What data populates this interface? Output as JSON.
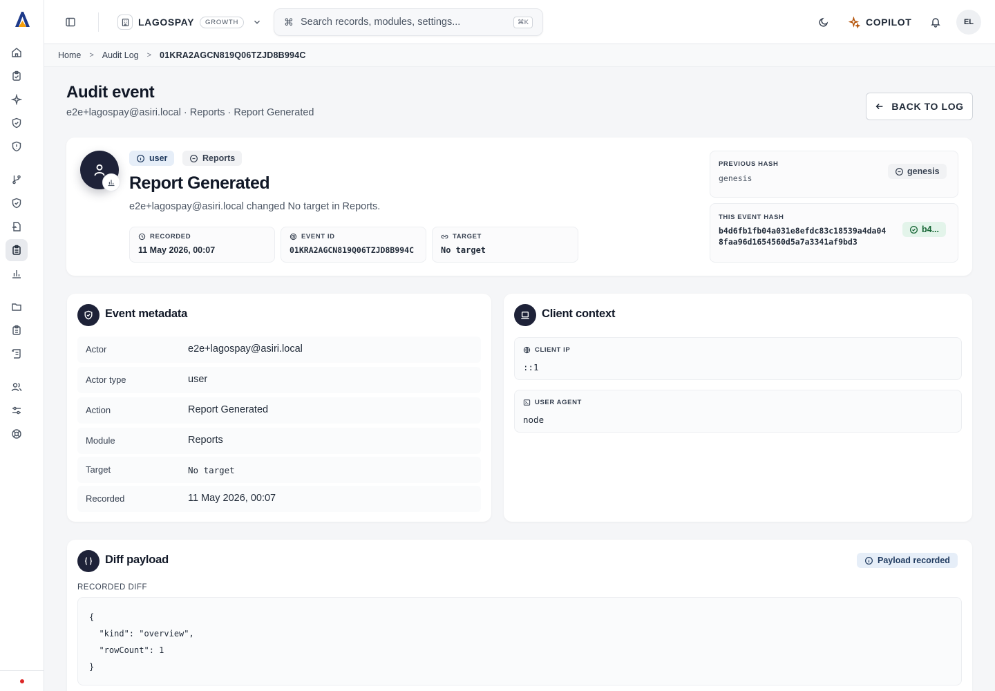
{
  "topbar": {
    "org_name": "LAGOSPAY",
    "org_plan": "GROWTH",
    "search_placeholder": "Search records, modules, settings...",
    "search_shortcut": "⌘K",
    "copilot_label": "COPILOT",
    "avatar_initials": "EL"
  },
  "breadcrumb": [
    "Home",
    "Audit Log",
    "01KRA2AGCN819Q06TZJD8B994C"
  ],
  "header": {
    "title": "Audit event",
    "subtitle": "e2e+lagospay@asiri.local · Reports · Report Generated",
    "back_label": "BACK TO LOG"
  },
  "event": {
    "actor_type_chip": "user",
    "module_chip": "Reports",
    "title": "Report Generated",
    "description": "e2e+lagospay@asiri.local changed No target in Reports.",
    "fields": [
      {
        "label": "RECORDED",
        "value": "11 May 2026, 00:07",
        "icon": "clock-icon"
      },
      {
        "label": "EVENT ID",
        "value": "01KRA2AGCN819Q06TZJD8B994C",
        "icon": "fingerprint-icon"
      },
      {
        "label": "TARGET",
        "value": "No target",
        "icon": "link-icon"
      }
    ],
    "previous_hash": {
      "label": "PREVIOUS HASH",
      "value": "genesis",
      "badge": "genesis"
    },
    "this_hash": {
      "label": "THIS EVENT HASH",
      "line1": "b4d6fb1fb04a031e8efdc83c18539a4da04",
      "line2": "8faa96d1654560d5a7a3341af9bd3",
      "badge": "b4..."
    }
  },
  "metadata": {
    "title": "Event metadata",
    "rows": [
      {
        "key": "Actor",
        "value": "e2e+lagospay@asiri.local"
      },
      {
        "key": "Actor type",
        "value": "user"
      },
      {
        "key": "Action",
        "value": "Report Generated"
      },
      {
        "key": "Module",
        "value": "Reports"
      },
      {
        "key": "Target",
        "value": "No target"
      },
      {
        "key": "Recorded",
        "value": "11 May 2026, 00:07"
      }
    ]
  },
  "client": {
    "title": "Client context",
    "ip_label": "CLIENT IP",
    "ip_value": "::1",
    "agent_label": "USER AGENT",
    "agent_value": "node"
  },
  "diff": {
    "title": "Diff payload",
    "badge": "Payload recorded",
    "label": "RECORDED DIFF",
    "lines": [
      "{",
      "  \"kind\": \"overview\",",
      "  \"rowCount\": 1",
      "}"
    ]
  }
}
